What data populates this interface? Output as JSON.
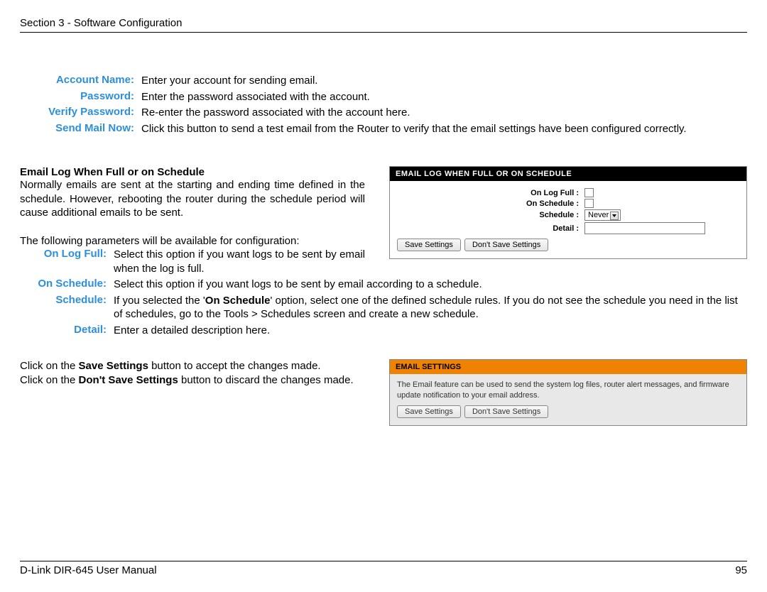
{
  "header": "Section 3 - Software Configuration",
  "defs1": [
    {
      "label": "Account Name:",
      "val": "Enter your account for sending email."
    },
    {
      "label": "Password:",
      "val": "Enter the password associated with the account."
    },
    {
      "label": "Verify Password:",
      "val": "Re-enter the password associated with the account here."
    },
    {
      "label": "Send Mail Now:",
      "val": "Click this button to send a test email from the Router to verify that the email settings have been configured correctly."
    }
  ],
  "sub1": "Email Log When Full or on Schedule",
  "para1": "Normally emails are sent at the starting and ending time defined in the schedule. However, rebooting the router during the schedule period will cause additional emails to be sent.",
  "para2": "The following parameters will be available for configuration:",
  "defs2a_label": "On Log Full:",
  "defs2a_val": "Select this option if you want logs to be sent by email when the log is full.",
  "defs2b": [
    {
      "label": "On Schedule:",
      "val": "Select this option if you want logs to be sent by email according to a schedule."
    },
    {
      "label": "Schedule:",
      "val_parts": [
        "If you selected the '",
        "On Schedule",
        "' option, select one of the defined schedule rules. If you do not see the schedule you need in the list of schedules, go to the Tools > Schedules screen and create a new schedule."
      ]
    },
    {
      "label": "Detail:",
      "val": "Enter a detailed description here."
    }
  ],
  "para3_parts": [
    "Click on the ",
    "Save Settings",
    " button to accept the changes made."
  ],
  "para4_parts": [
    "Click on the ",
    "Don't Save Settings",
    " button to discard the changes made."
  ],
  "fig1": {
    "title": "EMAIL LOG WHEN FULL OR ON SCHEDULE",
    "rows": [
      {
        "label": "On Log Full  :",
        "type": "chk"
      },
      {
        "label": "On Schedule  :",
        "type": "chk"
      },
      {
        "label": "Schedule  :",
        "type": "sel",
        "value": "Never"
      },
      {
        "label": "Detail  :",
        "type": "txt"
      }
    ],
    "btn1": "Save Settings",
    "btn2": "Don't Save Settings"
  },
  "fig2": {
    "title": "EMAIL SETTINGS",
    "text": "The Email feature can be used to send the system log files, router alert messages, and firmware update notification to your email address.",
    "btn1": "Save Settings",
    "btn2": "Don't Save Settings"
  },
  "footer_left": "D-Link DIR-645 User Manual",
  "footer_right": "95"
}
